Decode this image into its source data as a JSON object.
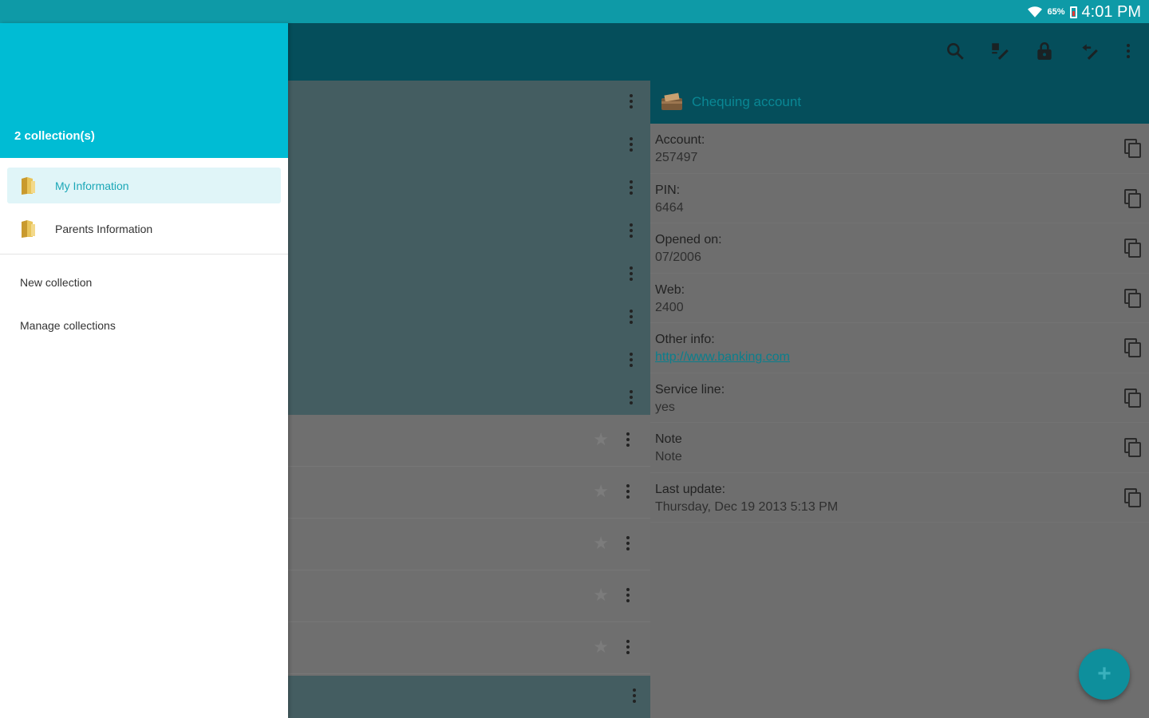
{
  "status_bar": {
    "battery": "65%",
    "time": "4:01 PM"
  },
  "colors": {
    "status_bar": "#0e9aa7",
    "drawer_header": "#00bcd4",
    "toolbar": "#054e5b",
    "accent": "#1ba7b7"
  },
  "drawer": {
    "collection_count": "2 collection(s)",
    "collections": [
      {
        "label": "My Information",
        "icon": "folder-icon",
        "active": true
      },
      {
        "label": "Parents Information",
        "icon": "folder-icon",
        "active": false
      }
    ],
    "actions": [
      {
        "label": "New collection"
      },
      {
        "label": "Manage collections"
      }
    ]
  },
  "toolbar": {
    "icons": [
      "search-icon",
      "edit-icon",
      "lock-icon",
      "undo-edit-icon",
      "more-vert-icon"
    ]
  },
  "detail": {
    "title": "Chequing account",
    "fields": [
      {
        "label": "Account:",
        "value": "257497"
      },
      {
        "label": "PIN:",
        "value": "6464"
      },
      {
        "label": "Opened on:",
        "value": "07/2006"
      },
      {
        "label": "Web:",
        "value": "2400"
      },
      {
        "label": "Other info:",
        "value": "http://www.banking.com",
        "link": true
      },
      {
        "label": "Service line:",
        "value": "yes"
      },
      {
        "label": "Note",
        "value": "Note"
      },
      {
        "label": "Last update:",
        "value": "Thursday, Dec 19 2013 5:13 PM"
      }
    ]
  },
  "fab": {
    "label": "+"
  }
}
